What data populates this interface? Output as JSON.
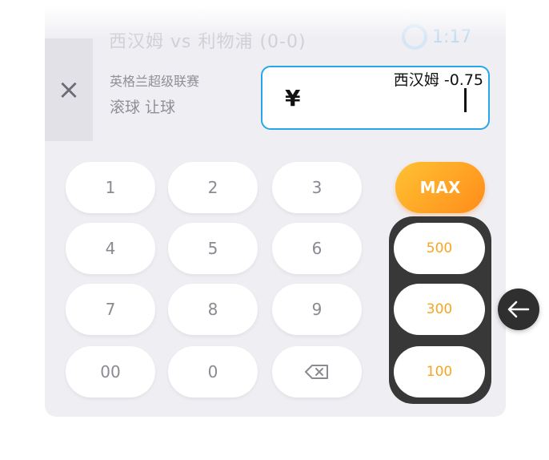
{
  "match": {
    "title": "西汉姆 vs 利物浦 (0-0)",
    "live_time": "1:17"
  },
  "bet": {
    "league": "英格兰超级联赛",
    "type": "滚球 让球",
    "selection": "西汉姆 -0.75",
    "currency": "¥",
    "amount": ""
  },
  "keypad": {
    "keys": [
      "1",
      "2",
      "3",
      "4",
      "5",
      "6",
      "7",
      "8",
      "9",
      "00",
      "0"
    ],
    "backspace_icon": "backspace-icon"
  },
  "quick_amounts": {
    "max_label": "MAX",
    "presets": [
      "500",
      "300",
      "100"
    ]
  },
  "colors": {
    "accent": "#2aa6e8",
    "preset_text": "#f5a623",
    "max_gradient_start": "#ffc233",
    "max_gradient_end": "#ff8c1a"
  }
}
